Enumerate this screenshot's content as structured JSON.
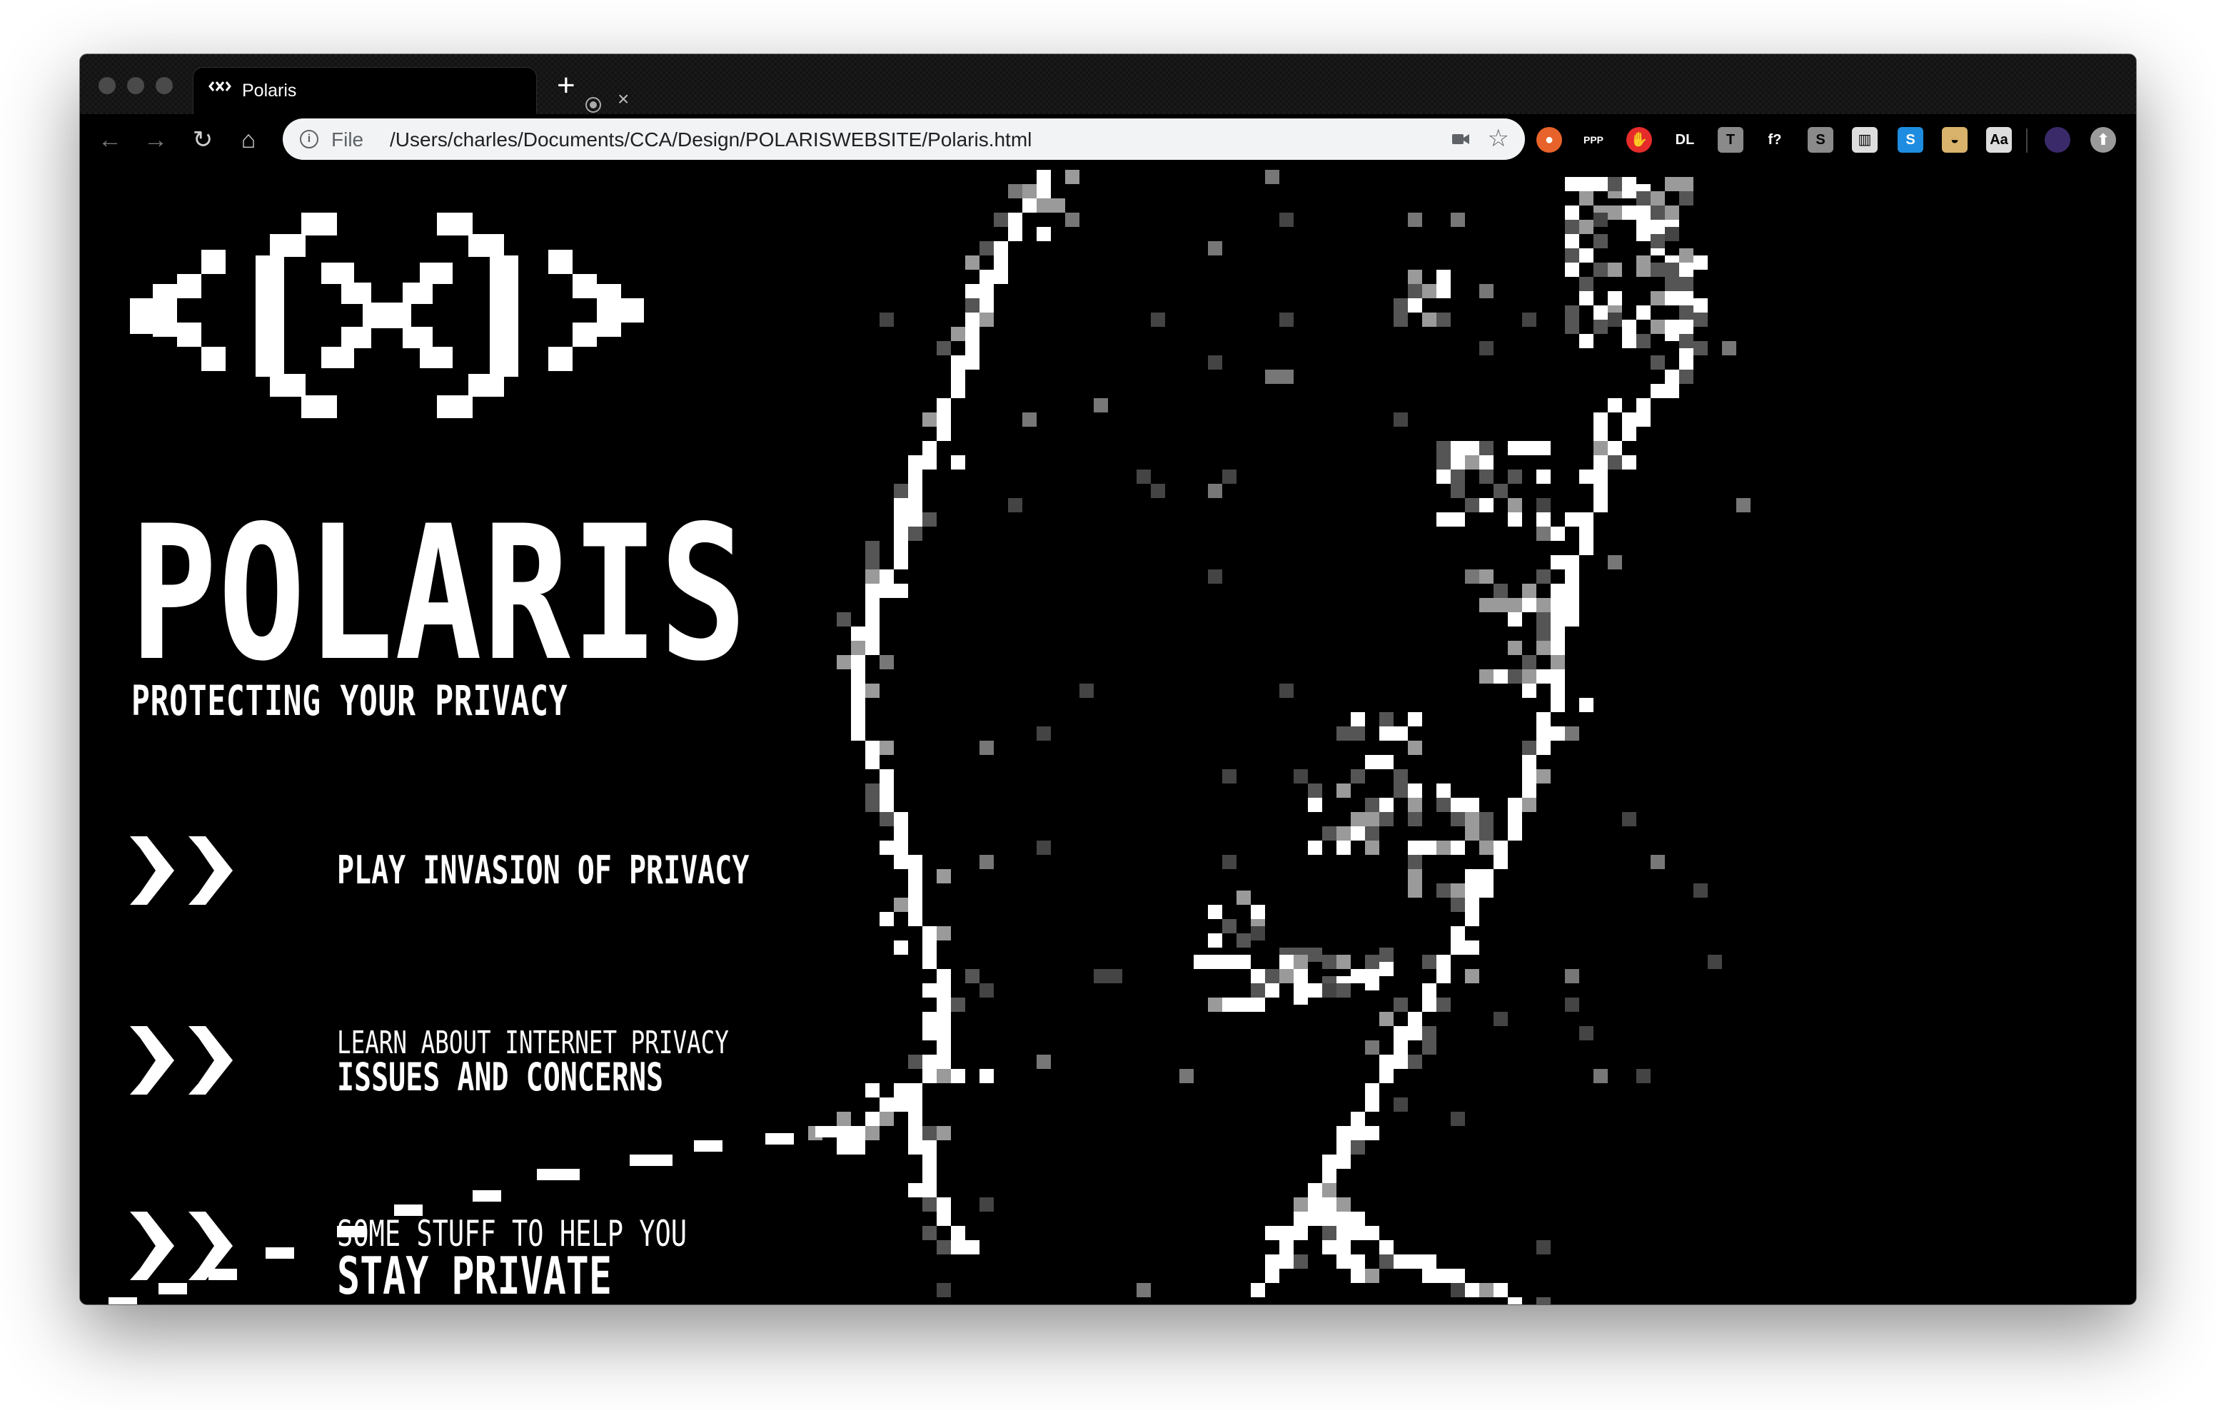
{
  "browser": {
    "tab_title": "Polaris",
    "tab_favicon_text": "POLARIS",
    "new_tab_label": "+",
    "close_label": "×",
    "nav": {
      "back": "←",
      "forward": "→",
      "reload": "↻",
      "home": "⌂"
    },
    "omnibox": {
      "info": "i",
      "scheme": "File",
      "url": "/Users/charles/Documents/CCA/Design/POLARISWEBSITE/Polaris.html"
    },
    "star": "☆",
    "extensions": [
      {
        "name": "duckduckgo-extension-icon",
        "color": "#e8632b",
        "glyph": "●"
      },
      {
        "name": "ppp-extension-icon",
        "color": "#000000",
        "glyph": "PPP"
      },
      {
        "name": "adblock-extension-icon",
        "color": "#e62b2b",
        "glyph": "✋"
      },
      {
        "name": "dl-extension-icon",
        "color": "#000000",
        "glyph": "DL"
      },
      {
        "name": "t-extension-icon",
        "color": "#8a8a8a",
        "glyph": "T"
      },
      {
        "name": "fonts-query-extension-icon",
        "color": "#000000",
        "glyph": "f?"
      },
      {
        "name": "s-extension-icon",
        "color": "#8a8a8a",
        "glyph": "S"
      },
      {
        "name": "columns-extension-icon",
        "color": "#dddddd",
        "glyph": "▥"
      },
      {
        "name": "skype-extension-icon",
        "color": "#1e8de1",
        "glyph": "S"
      },
      {
        "name": "lips-extension-icon",
        "color": "#d9b36b",
        "glyph": "◒"
      },
      {
        "name": "fonts-extension-icon",
        "color": "#dddddd",
        "glyph": "Aa"
      }
    ]
  },
  "page": {
    "brand": "POLARIS",
    "tagline": "PROTECTING YOUR PRIVACY",
    "menu": [
      {
        "line1": "PLAY INVASION OF PRIVACY",
        "line2": ""
      },
      {
        "line1": "LEARN ABOUT INTERNET PRIVACY",
        "line2": "ISSUES AND CONCERNS"
      },
      {
        "line1": "SOME STUFF TO HELP YOU",
        "line2": "STAY PRIVATE"
      }
    ]
  }
}
